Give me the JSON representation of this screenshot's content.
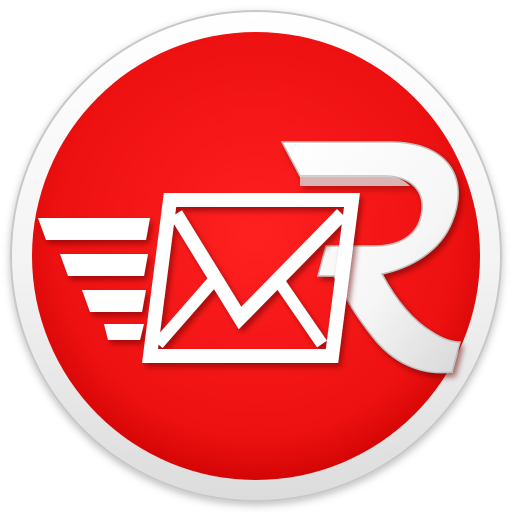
{
  "app_icon": {
    "name": "mail-app-logo",
    "letter": "R",
    "colors": {
      "background": "#ffffff",
      "ring": "#f2f2f2",
      "ring_edge": "#c8c8c8",
      "disc": "#ee1111",
      "disc_dark": "#c80000",
      "glyph": "#ffffff",
      "glyph_shadow": "#8a0000",
      "glyph_bevel": "#d4d4d4"
    },
    "icons": [
      "envelope-icon",
      "speed-lines-icon",
      "letter-r-icon"
    ]
  }
}
